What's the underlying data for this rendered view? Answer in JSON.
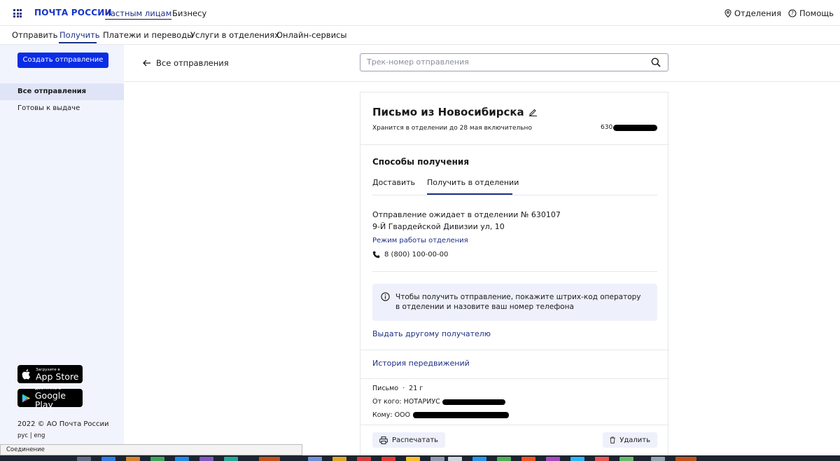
{
  "header": {
    "logo": "ПОЧТА РОССИИ",
    "nav": [
      "Частным лицам",
      "Бизнесу"
    ],
    "offices": "Отделения",
    "help": "Помощь"
  },
  "subnav": [
    "Отправить",
    "Получить",
    "Платежи и переводы",
    "Услуги в отделениях",
    "Онлайн-сервисы"
  ],
  "sidebar": {
    "create_button": "Создать отправление",
    "items": [
      "Все отправления",
      "Готовы к выдаче"
    ],
    "appstore_small": "Загрузите в",
    "appstore_big": "App Store",
    "googleplay_small": "ДОСТУПНО В",
    "googleplay_big": "Google Play",
    "copyright": "2022 © АО Почта России",
    "lang": "рус | eng"
  },
  "main": {
    "back_label": "Все отправления",
    "search_placeholder": "Трек-номер отправления"
  },
  "card": {
    "title": "Письмо из Новосибирска",
    "storage_note": "Хранится в отделении до 28 мая включительно",
    "track_prefix": "630",
    "receive_title": "Способы получения",
    "tabs": [
      "Доставить",
      "Получить в отделении"
    ],
    "office_line1": "Отправление ожидает в отделении № 630107",
    "office_line2": "9-Й Гвардейской Дивизии ул, 10",
    "hours_link": "Режим работы отделения",
    "phone": "8 (800) 100-00-00",
    "info_line1": "Чтобы получить отправление, покажите штрих-код оператору",
    "info_line2": "в отделении и назовите ваш номер телефона",
    "other_recipient": "Выдать другому получателю",
    "history": "История передвижений",
    "type": "Письмо",
    "dot": "·",
    "weight": "21 г",
    "from_label": "От кого: НОТАРИУС",
    "to_label": "Кому: ООО",
    "print_button": "Распечатать",
    "delete_button": "Удалить"
  },
  "statusbar": "Соединение",
  "colors": {
    "brand": "#1734c7",
    "accent": "#0a2ce6",
    "navy": "#1e2f86",
    "sidebar_bg": "#f2f4fd",
    "info_bg": "#eef1fb"
  }
}
